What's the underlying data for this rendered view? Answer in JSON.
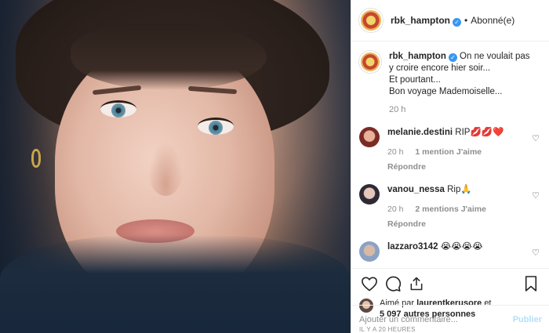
{
  "header": {
    "username": "rbk_hampton",
    "verified_icon": "✓",
    "separator": "•",
    "follow_status": "Abonné(e)"
  },
  "caption": {
    "username": "rbk_hampton",
    "verified_icon": "✓",
    "line1": "On ne voulait pas y croire encore hier soir...",
    "line2": "Et pourtant...",
    "line3": "Bon voyage Mademoiselle...",
    "time": "20 h"
  },
  "comments": [
    {
      "username": "melanie.destini",
      "text": "RIP💋💋❤️",
      "time": "20 h",
      "likes": "1 mention J'aime",
      "reply": "Répondre"
    },
    {
      "username": "vanou_nessa",
      "text": "Rip🙏",
      "time": "20 h",
      "likes": "2 mentions J'aime",
      "reply": "Répondre"
    },
    {
      "username": "lazzaro3142",
      "text": "😭😭😭😭",
      "time": "",
      "likes": "",
      "reply": ""
    }
  ],
  "liked_by": {
    "prefix": "Aimé par",
    "user": "laurentkerusore",
    "conj": "et",
    "others": "5 097 autres personnes"
  },
  "time_ago": "IL Y A 20 HEURES",
  "add_comment": {
    "placeholder": "Ajouter un commentaire...",
    "publish_label": "Publier"
  },
  "colors": {
    "accent": "#3897f0",
    "muted": "#8e8e8e",
    "publish_disabled": "#b2dffc"
  }
}
